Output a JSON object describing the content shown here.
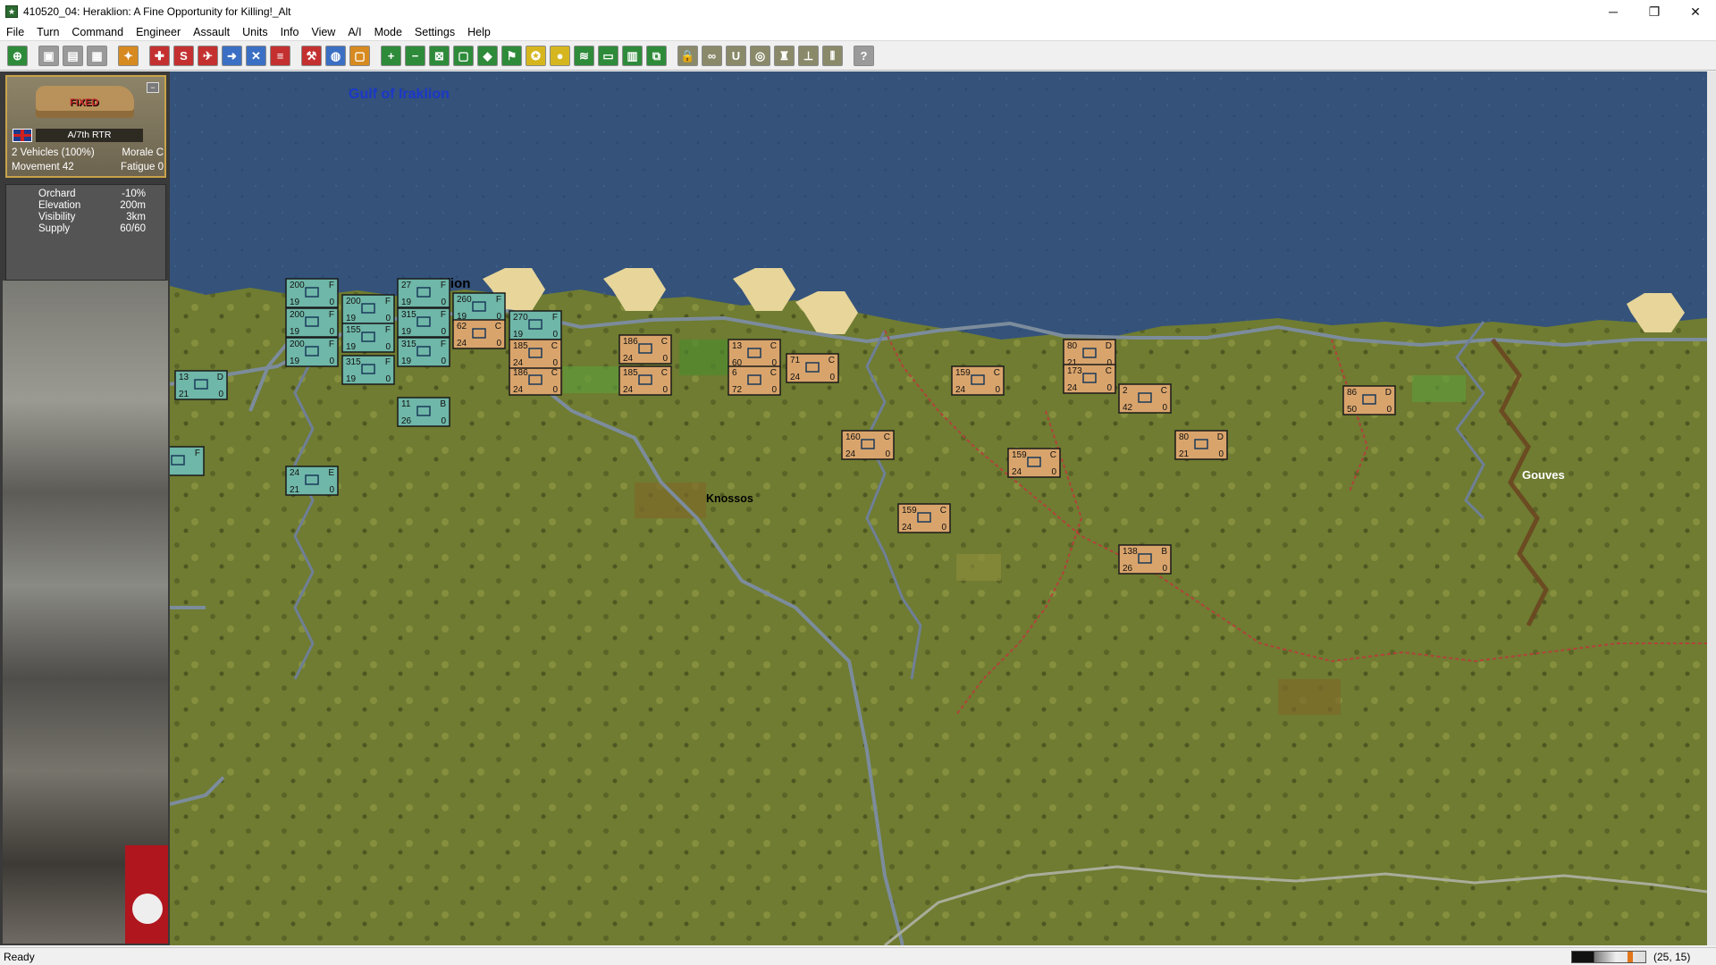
{
  "window": {
    "title": "410520_04: Heraklion: A Fine Opportunity for Killing!_Alt",
    "controls": [
      "─",
      "❐",
      "✕"
    ]
  },
  "menu": [
    "File",
    "Turn",
    "Command",
    "Engineer",
    "Assault",
    "Units",
    "Info",
    "View",
    "A/I",
    "Mode",
    "Settings",
    "Help"
  ],
  "toolbar": [
    {
      "icon": "jump-icon",
      "color": "#2e8b3a",
      "glyph": "⊕"
    },
    {
      "gap": true
    },
    {
      "icon": "save-icon",
      "color": "#9a9a9a",
      "glyph": "▣"
    },
    {
      "icon": "open-icon",
      "color": "#9a9a9a",
      "glyph": "▤"
    },
    {
      "icon": "print-icon",
      "color": "#9a9a9a",
      "glyph": "▦"
    },
    {
      "gap": true
    },
    {
      "icon": "reinforce-icon",
      "color": "#d68a1f",
      "glyph": "✦"
    },
    {
      "gap": true
    },
    {
      "icon": "artillery-icon",
      "color": "#c43030",
      "glyph": "✚"
    },
    {
      "icon": "supply-icon",
      "color": "#c43030",
      "glyph": "S"
    },
    {
      "icon": "air-icon",
      "color": "#c43030",
      "glyph": "✈"
    },
    {
      "icon": "move-icon",
      "color": "#3b6fc4",
      "glyph": "➜"
    },
    {
      "icon": "airstrike-icon",
      "color": "#3b6fc4",
      "glyph": "✕"
    },
    {
      "icon": "report-icon",
      "color": "#c43030",
      "glyph": "≡"
    },
    {
      "gap": true
    },
    {
      "icon": "engineer-icon",
      "color": "#c43030",
      "glyph": "⚒"
    },
    {
      "icon": "globe-icon",
      "color": "#3b6fc4",
      "glyph": "◍"
    },
    {
      "icon": "info-icon",
      "color": "#d68a1f",
      "glyph": "▢"
    },
    {
      "gap": true
    },
    {
      "icon": "zoom-in-icon",
      "color": "#2e8b3a",
      "glyph": "+"
    },
    {
      "icon": "zoom-out-icon",
      "color": "#2e8b3a",
      "glyph": "−"
    },
    {
      "icon": "hex-grid-icon",
      "color": "#2e8b3a",
      "glyph": "⊠"
    },
    {
      "icon": "frame-icon",
      "color": "#2e8b3a",
      "glyph": "▢"
    },
    {
      "icon": "diamond-icon",
      "color": "#2e8b3a",
      "glyph": "◆"
    },
    {
      "icon": "flag-icon",
      "color": "#2e8b3a",
      "glyph": "⚑"
    },
    {
      "icon": "unit-icon",
      "color": "#d6b61f",
      "glyph": "✪"
    },
    {
      "icon": "medal-icon",
      "color": "#d6b61f",
      "glyph": "●"
    },
    {
      "icon": "terrain-icon",
      "color": "#2e8b3a",
      "glyph": "≋"
    },
    {
      "icon": "monitor-icon",
      "color": "#2e8b3a",
      "glyph": "▭"
    },
    {
      "icon": "map-icon",
      "color": "#2e8b3a",
      "glyph": "▥"
    },
    {
      "icon": "link-icon",
      "color": "#2e8b3a",
      "glyph": "⧉"
    },
    {
      "gap": true
    },
    {
      "icon": "lock-icon",
      "color": "#8a8a6a",
      "glyph": "🔒"
    },
    {
      "icon": "binocular-icon",
      "color": "#8a8a6a",
      "glyph": "∞"
    },
    {
      "icon": "u-icon",
      "color": "#8a8a6a",
      "glyph": "U"
    },
    {
      "icon": "circle-icon",
      "color": "#8a8a6a",
      "glyph": "◎"
    },
    {
      "icon": "castle-icon",
      "color": "#8a8a6a",
      "glyph": "♜"
    },
    {
      "icon": "org-icon",
      "color": "#8a8a6a",
      "glyph": "⊥"
    },
    {
      "icon": "bracket-icon",
      "color": "#8a8a6a",
      "glyph": "⫴"
    },
    {
      "gap": true
    },
    {
      "icon": "help-icon",
      "color": "#9a9a9a",
      "glyph": "?"
    }
  ],
  "unit_card": {
    "status": "FIXED",
    "unit_name": "A/7th RTR",
    "vehicles": "2 Vehicles (100%)",
    "morale": "Morale C",
    "movement": "Movement 42",
    "fatigue": "Fatigue 0"
  },
  "terrain": [
    {
      "label": "Orchard",
      "value": "-10%"
    },
    {
      "label": "Elevation",
      "value": "200m"
    },
    {
      "label": "Visibility",
      "value": "3km"
    },
    {
      "label": "Supply",
      "value": "60/60"
    }
  ],
  "map_labels": {
    "gulf": "Gulf of Iraklion",
    "heraklion": "Heraklion",
    "knossos": "Knossos",
    "gouves": "Gouves"
  },
  "colors": {
    "sea": "#34527a",
    "land": "#6d7a2f",
    "beach": "#e7d59a",
    "allied_counter": "#6fb7a8",
    "axis_counter": "#d9a46c",
    "road": "#7c8c9c",
    "river": "#6f7f96",
    "trail": "#b3413a"
  },
  "units": [
    {
      "side": "allied",
      "top": "200",
      "cls": "F",
      "bl": "19",
      "br": "0"
    },
    {
      "side": "allied",
      "top": "200",
      "cls": "F",
      "bl": "19",
      "br": "0"
    },
    {
      "side": "allied",
      "top": "200",
      "cls": "F",
      "bl": "19",
      "br": "0"
    },
    {
      "side": "allied",
      "top": "200",
      "cls": "F",
      "bl": "19",
      "br": "0"
    },
    {
      "side": "allied",
      "top": "27",
      "cls": "F",
      "bl": "19",
      "br": "0"
    },
    {
      "side": "allied",
      "top": "315",
      "cls": "F",
      "bl": "19",
      "br": "0"
    },
    {
      "side": "allied",
      "top": "315",
      "cls": "F",
      "bl": "19",
      "br": "0"
    },
    {
      "side": "allied",
      "top": "315",
      "cls": "F",
      "bl": "19",
      "br": "0"
    },
    {
      "side": "allied",
      "top": "155",
      "cls": "F",
      "bl": "19",
      "br": "0"
    },
    {
      "side": "allied",
      "top": "260",
      "cls": "F",
      "bl": "19",
      "br": "0"
    },
    {
      "side": "allied",
      "top": "270",
      "cls": "F",
      "bl": "19",
      "br": "0"
    },
    {
      "side": "allied",
      "top": "11",
      "cls": "B",
      "bl": "26",
      "br": "0"
    },
    {
      "side": "allied",
      "top": "13",
      "cls": "D",
      "bl": "21",
      "br": "0"
    },
    {
      "side": "allied",
      "top": "24",
      "cls": "E",
      "bl": "21",
      "br": "0"
    },
    {
      "side": "allied",
      "top": "",
      "cls": "F",
      "bl": "",
      "br": ""
    },
    {
      "side": "axis",
      "top": "62",
      "cls": "C",
      "bl": "24",
      "br": "0"
    },
    {
      "side": "axis",
      "top": "186",
      "cls": "C",
      "bl": "24",
      "br": "0"
    },
    {
      "side": "axis",
      "top": "186",
      "cls": "C",
      "bl": "24",
      "br": "0"
    },
    {
      "side": "axis",
      "top": "185",
      "cls": "C",
      "bl": "24",
      "br": "0"
    },
    {
      "side": "axis",
      "top": "185",
      "cls": "C",
      "bl": "24",
      "br": "0"
    },
    {
      "side": "axis",
      "top": "13",
      "cls": "C",
      "bl": "60",
      "br": "0"
    },
    {
      "side": "axis",
      "top": "6",
      "cls": "C",
      "bl": "72",
      "br": "0"
    },
    {
      "side": "axis",
      "top": "71",
      "cls": "C",
      "bl": "24",
      "br": "0"
    },
    {
      "side": "axis",
      "top": "160",
      "cls": "C",
      "bl": "24",
      "br": "0"
    },
    {
      "side": "axis",
      "top": "159",
      "cls": "C",
      "bl": "24",
      "br": "0"
    },
    {
      "side": "axis",
      "top": "159",
      "cls": "C",
      "bl": "24",
      "br": "0"
    },
    {
      "side": "axis",
      "top": "159",
      "cls": "C",
      "bl": "24",
      "br": "0"
    },
    {
      "side": "axis",
      "top": "80",
      "cls": "D",
      "bl": "21",
      "br": "0"
    },
    {
      "side": "axis",
      "top": "173",
      "cls": "C",
      "bl": "24",
      "br": "0"
    },
    {
      "side": "axis",
      "top": "2",
      "cls": "C",
      "bl": "42",
      "br": "0"
    },
    {
      "side": "axis",
      "top": "80",
      "cls": "D",
      "bl": "21",
      "br": "0"
    },
    {
      "side": "axis",
      "top": "138",
      "cls": "B",
      "bl": "26",
      "br": "0"
    },
    {
      "side": "axis",
      "top": "86",
      "cls": "D",
      "bl": "50",
      "br": "0"
    }
  ],
  "status": {
    "text": "Ready",
    "coords": "(25, 15)"
  }
}
